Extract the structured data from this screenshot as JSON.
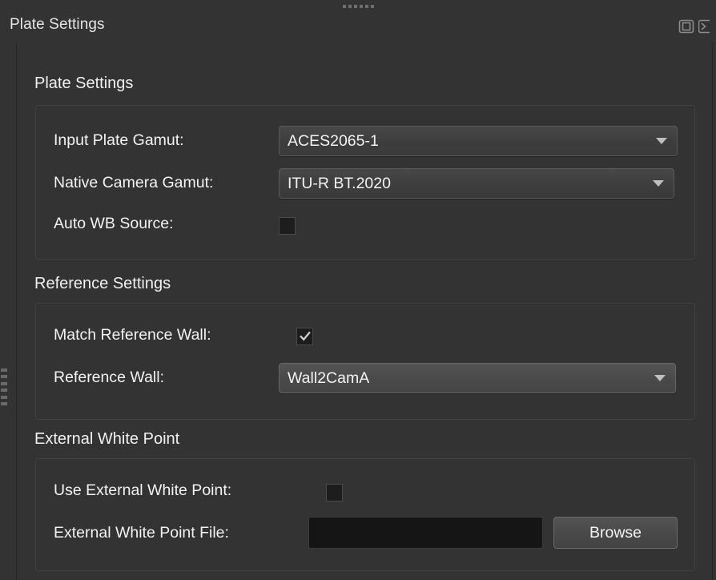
{
  "window": {
    "title": "Plate Settings",
    "titlebar_icons": [
      {
        "name": "float-window-icon",
        "label": "Float"
      },
      {
        "name": "close-panel-icon",
        "label": "Close"
      }
    ],
    "grips": {
      "top_handle": "drag-handle",
      "left_handle": "drag-handle"
    }
  },
  "colors": {
    "background": "#333333",
    "groupbox_border": "#404040",
    "text": "#f2f2f2",
    "combo_bg": "#3e3e3e",
    "combo_border": "#5a5a5a",
    "input_bg": "#151515",
    "button_bg": "#4a4a4a"
  },
  "sections": [
    {
      "heading": "Plate Settings",
      "fields": [
        {
          "label": "Input Plate Gamut:",
          "type": "combobox",
          "value": "ACES2065-1",
          "icon": "chevron-down-icon"
        },
        {
          "label": "Native Camera Gamut:",
          "type": "combobox",
          "value": "ITU-R BT.2020",
          "icon": "chevron-down-icon"
        },
        {
          "label": "Auto WB Source:",
          "type": "checkbox",
          "checked": false
        }
      ]
    },
    {
      "heading": "Reference Settings",
      "fields": [
        {
          "label": "Match Reference Wall:",
          "type": "checkbox",
          "checked": true
        },
        {
          "label": "Reference Wall:",
          "type": "combobox",
          "value": "Wall2CamA",
          "icon": "chevron-down-icon"
        }
      ]
    },
    {
      "heading": "External White Point",
      "fields": [
        {
          "label": "Use External White Point:",
          "type": "checkbox",
          "checked": false
        },
        {
          "label": "External White Point File:",
          "type": "fileinput",
          "value": "",
          "placeholder": "",
          "button_label": "Browse"
        }
      ]
    }
  ]
}
